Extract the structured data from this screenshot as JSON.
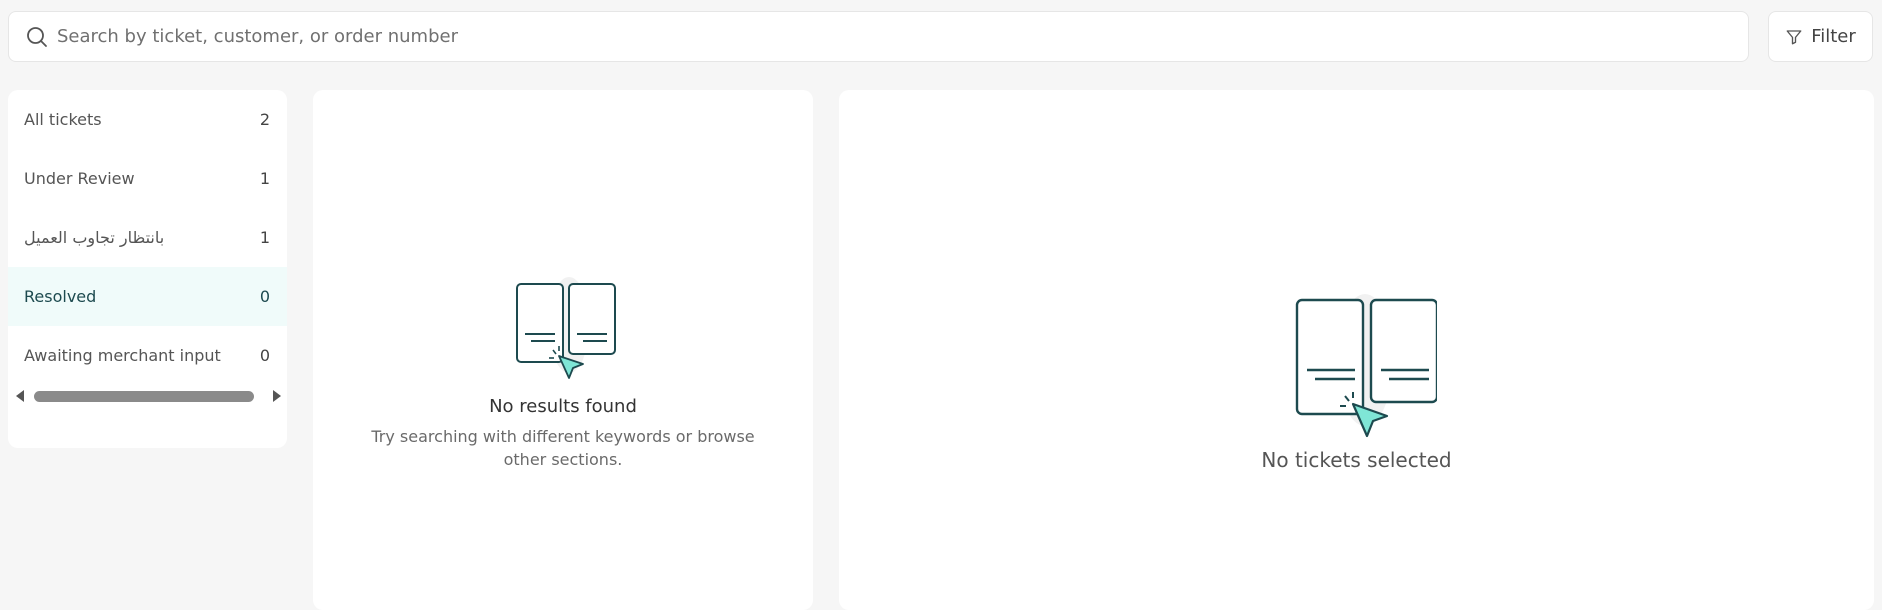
{
  "search": {
    "placeholder": "Search by ticket, customer, or order number",
    "value": ""
  },
  "filter": {
    "label": "Filter"
  },
  "sidebar": {
    "items": [
      {
        "label": "All tickets",
        "count": "2"
      },
      {
        "label": "Under Review",
        "count": "1"
      },
      {
        "label": "بانتظار تجاوب العميل",
        "count": "1"
      },
      {
        "label": "Resolved",
        "count": "0",
        "active": true
      },
      {
        "label": "Awaiting merchant input",
        "count": "0"
      }
    ]
  },
  "list_panel": {
    "empty_title": "No results found",
    "empty_description": "Try searching with different keywords or browse other sections."
  },
  "detail_panel": {
    "empty_title": "No tickets selected"
  },
  "colors": {
    "accent": "#1d4a4f",
    "accent_light": "#7fe6d6",
    "active_bg": "#f0fbfa"
  }
}
